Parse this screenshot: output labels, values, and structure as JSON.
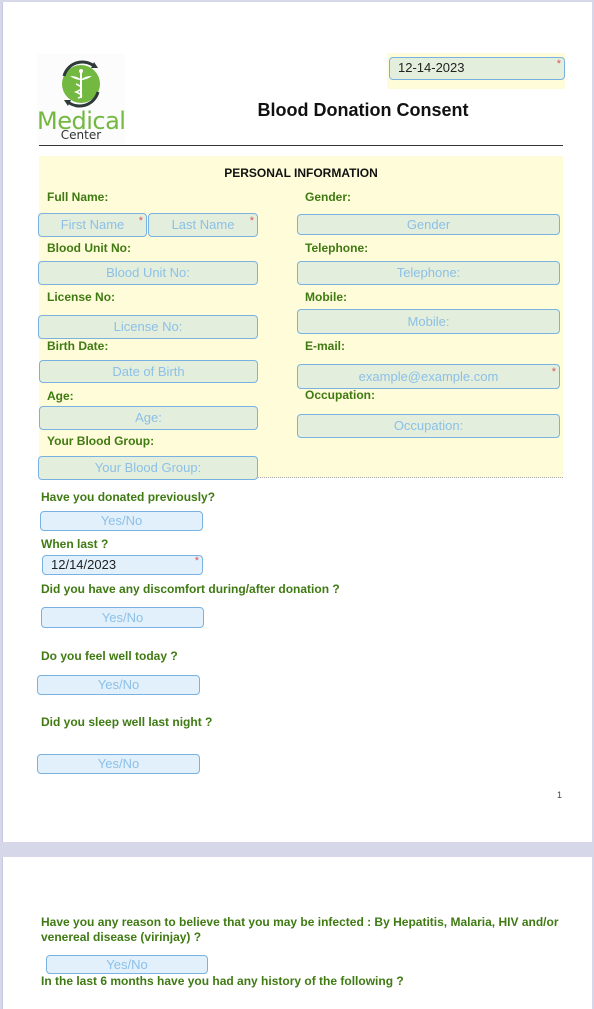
{
  "header": {
    "logo": {
      "line1": "Medical",
      "line2": "Center",
      "icon": "caduceus-icon"
    },
    "date_value": "12-14-2023",
    "title": "Blood Donation Consent"
  },
  "personal_information": {
    "title": "PERSONAL INFORMATION",
    "left": [
      {
        "label": "Full Name:",
        "fields": [
          {
            "placeholder": "First Name",
            "required": true
          },
          {
            "placeholder": "Last Name",
            "required": true
          }
        ]
      },
      {
        "label": "Blood Unit No:",
        "placeholder": "Blood Unit No:"
      },
      {
        "label": "License No:",
        "placeholder": "License No:"
      },
      {
        "label": "Birth Date:",
        "placeholder": "Date of Birth"
      },
      {
        "label": "Age:",
        "placeholder": "Age:"
      },
      {
        "label": "Your Blood Group:",
        "placeholder": "Your Blood Group:"
      }
    ],
    "right": [
      {
        "label": "Gender:",
        "placeholder": "Gender"
      },
      {
        "label": "Telephone:",
        "placeholder": "Telephone:"
      },
      {
        "label": "Mobile:",
        "placeholder": "Mobile:"
      },
      {
        "label": "E-mail:",
        "placeholder": "example@example.com",
        "required": true
      },
      {
        "label": "Occupation:",
        "placeholder": "Occupation:"
      }
    ]
  },
  "questions": [
    {
      "label": "Have you donated previously?",
      "placeholder": "Yes/No"
    },
    {
      "label": "When last ?",
      "value": "12/14/2023",
      "required": true
    },
    {
      "label": "Did you have any discomfort during/after donation ?",
      "placeholder": "Yes/No"
    },
    {
      "label": "Do you feel well today ?",
      "placeholder": "Yes/No"
    },
    {
      "label": "Did you sleep well last night ?",
      "placeholder": "Yes/No"
    }
  ],
  "page1_number": "1",
  "page2": {
    "question1_line1": "Have you any reason to believe that you may be infected :  By Hepatitis, Malaria, HIV and/or",
    "question1_line2": "venereal  disease (virinjay) ?",
    "question1_placeholder": "Yes/No",
    "question2": "In the last 6 months have you had any history of the following ?"
  }
}
